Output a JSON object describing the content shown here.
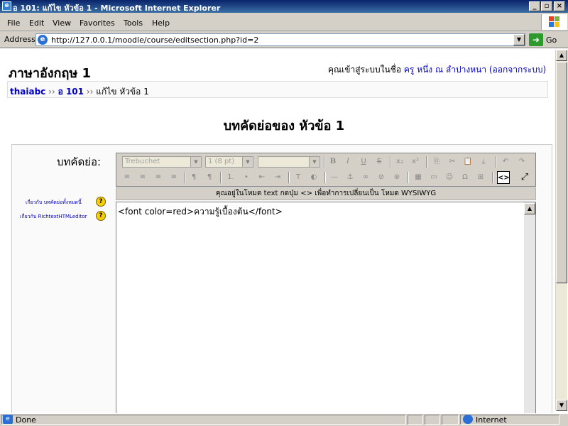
{
  "window": {
    "title": "อ 101: แก้ไข หัวข้อ 1 - Microsoft Internet Explorer",
    "minimize": "_",
    "restore": "▫",
    "close": "×"
  },
  "menu": [
    "File",
    "Edit",
    "View",
    "Favorites",
    "Tools",
    "Help"
  ],
  "address": {
    "label": "Address",
    "url": "http://127.0.0.1/moodle/course/editsection.php?id=2",
    "go_label": "Go"
  },
  "page": {
    "course_title": "ภาษาอังกฤษ 1",
    "login_prefix": "คุณเข้าสู่ระบบในชื่อ",
    "login_user": "ครู หนึ่ง ณ ลำปางหนา",
    "logout_text": "(ออกจากระบบ)",
    "breadcrumb": [
      "thaiabc",
      "อ 101",
      "แก้ไข หัวข้อ 1"
    ],
    "breadcrumb_sep": "››",
    "heading": "บทคัดย่อของ หัวข้อ 1",
    "summary_label": "บทคัดย่อ:",
    "help_links": [
      "เกี่ยวกับ บทคัดย่อทั้งหมดนี้",
      "เกี่ยวกับ RichtextHTMLeditor"
    ],
    "help_icon": "?"
  },
  "editor": {
    "font_family": "Trebuchet",
    "font_size": "1 (8 pt)",
    "format": "",
    "status_message": "คุณอยู่ในโหมด text กดปุ่ม <> เพื่อทำการเปลี่ยนเป็น โหมด WYSIWYG",
    "content": "<font color=red>ความรู้เบื้องต้น</font>",
    "buttons_row1": [
      "B",
      "I",
      "U",
      "S",
      "x₂",
      "x²",
      "⎘",
      "✂",
      "📋",
      "⤓",
      "↶",
      "↷"
    ],
    "buttons_row2": [
      "≡",
      "≡",
      "≡",
      "≡",
      "¶",
      "¶",
      "1.",
      "•",
      "⇤",
      "⇥",
      "T",
      "◐",
      "—",
      "⚓",
      "∞",
      "⊘",
      "⊛",
      "▦",
      "▭",
      "☺",
      "Ω",
      "⊞",
      "<>",
      "⤢"
    ]
  },
  "statusbar": {
    "done": "Done",
    "zone": "Internet"
  }
}
